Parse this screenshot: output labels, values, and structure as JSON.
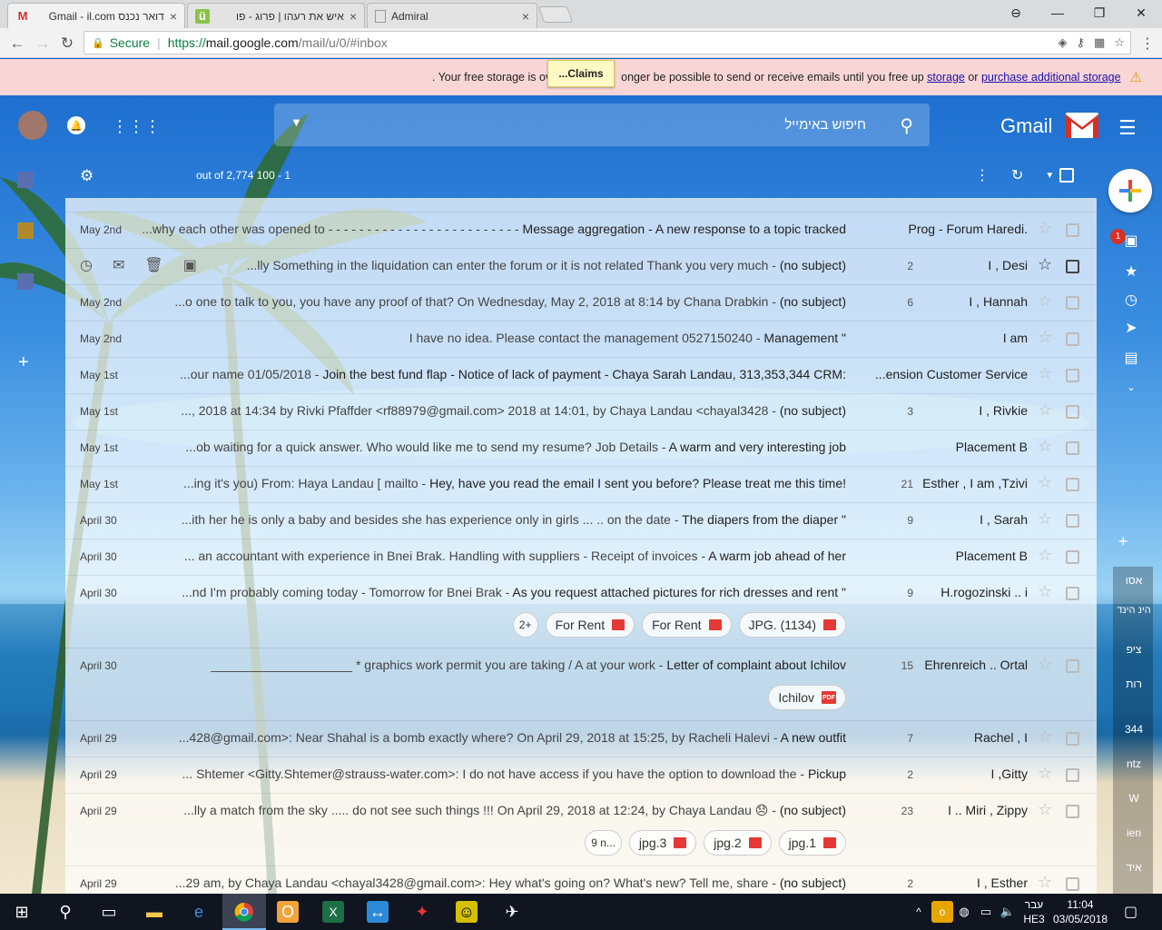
{
  "browser": {
    "tabs": [
      {
        "title": "דואר נכנס Gmail - il.com",
        "icon": "gmail-icon"
      },
      {
        "title": "איש את רעהו | פרוג - פו",
        "icon": "prog-icon"
      },
      {
        "title": "Admiral",
        "icon": "page-icon"
      }
    ],
    "close_glyph": "×",
    "url_secure_label": "Secure",
    "url_protocol": "https://",
    "url_host": "mail.google.com",
    "url_path": "/mail/u/0/#inbox"
  },
  "storage_warning": {
    "text_before": "Your free storage is ov",
    "text_mid": "onger be possible to send or receive emails until you free up",
    "link_storage": "storage",
    "or": "or",
    "link_purchase": "purchase additional storage",
    "trailing_dot": "."
  },
  "claims_popup": "...Claims",
  "gmail": {
    "logo_word": "Gmail",
    "search_placeholder": "חיפוש באימייל",
    "page_count": "out of 2,774 100 - 1"
  },
  "inbox_badge": "1",
  "hangouts_right": [
    "אסו",
    "הינ הינד",
    "ציפ",
    "רות",
    "344",
    "ntz",
    "W",
    "ien",
    "איד"
  ],
  "messages": [
    {
      "date": "May 2nd",
      "subject": "Message aggregation - A new response to a topic tracked",
      "snippet": "...why each other was opened to - - - - - - - - - - - - - - - - - - - - - - - -",
      "count": "",
      "sender": "Prog - Forum Haredi.",
      "chips": []
    },
    {
      "date": "",
      "subject": "(no subject)",
      "snippet": "...lly Something in the liquidation can enter the forum or it is not related Thank you very much",
      "count": "2",
      "sender": "I , Desi",
      "chips": [],
      "hover": true
    },
    {
      "date": "May 2nd",
      "subject": "(no subject)",
      "snippet": "...o one to talk to you, you have any proof of that? On Wednesday, May 2, 2018 at 8:14 by Chana Drabkin",
      "count": "6",
      "sender": "I , Hannah",
      "chips": []
    },
    {
      "date": "May 2nd",
      "subject": "Management \"",
      "snippet": "I have no idea. Please contact the management 0527150240",
      "count": "",
      "sender": "I am",
      "chips": []
    },
    {
      "date": "May 1st",
      "subject": "Join the best fund flap - Notice of lack of payment - Chaya Sarah Landau, 313,353,344 CRM:",
      "snippet": "...our name 01/05/2018",
      "count": "",
      "sender": "...ension Customer Service",
      "chips": []
    },
    {
      "date": "May 1st",
      "subject": "(no subject)",
      "snippet": "..., 2018 at 14:34 by Rivki Pfaffder <rf88979@gmail.com> 2018 at 14:01, by Chaya Landau <chayal3428",
      "count": "3",
      "sender": "I , Rivkie",
      "chips": []
    },
    {
      "date": "May 1st",
      "subject": "A warm and very interesting job",
      "snippet": "...ob waiting for a quick answer. Who would like me to send my resume? Job Details",
      "count": "",
      "sender": "Placement B",
      "chips": []
    },
    {
      "date": "May 1st",
      "subject": "Hey, have you read the email I sent you before? Please treat me this time!",
      "snippet": "...ing it's you) From: Haya Landau [ mailto",
      "count": "21",
      "sender": "Esther , I am ,Tzivi",
      "chips": []
    },
    {
      "date": "April 30",
      "subject": "The diapers from the diaper \"",
      "snippet": "...ith her he is only a baby and besides she has experience only in girls ... .. on the date",
      "count": "9",
      "sender": "I , Sarah",
      "chips": []
    },
    {
      "date": "April 30",
      "subject": "A warm job ahead of her",
      "snippet": "... an accountant with experience in Bnei Brak. Handling with suppliers - Receipt of invoices",
      "count": "",
      "sender": "Placement B",
      "chips": []
    },
    {
      "date": "April 30",
      "subject": "As you request attached pictures for rich dresses and rent \"",
      "snippet": "...nd I'm probably coming today - Tomorrow for Bnei Brak",
      "count": "9",
      "sender": "H.rogozinski .. i",
      "chips": [
        {
          "label": "JPG. (1134)",
          "type": "image"
        },
        {
          "label": "For Rent",
          "type": "image"
        },
        {
          "label": "For Rent",
          "type": "image"
        },
        {
          "label": "2+",
          "type": "more"
        }
      ]
    },
    {
      "date": "April 30",
      "subject": "Letter of complaint about Ichilov",
      "snippet": "____________________ * graphics work permit you are taking / A at your work",
      "count": "15",
      "sender": "Ehrenreich .. Ortal",
      "chips": [
        {
          "label": "Ichilov",
          "type": "pdf"
        }
      ]
    },
    {
      "date": "April 29",
      "subject": "A new outfit",
      "snippet": "...428@gmail.com>: Near Shahal is a bomb exactly where? On April 29, 2018 at 15:25, by Racheli Halevi",
      "count": "7",
      "sender": "Rachel , I",
      "chips": []
    },
    {
      "date": "April 29",
      "subject": "Pickup",
      "snippet": "... Shtemer <Gitty.Shtemer@strauss-water.com>: I do not have access if you have the option to download the",
      "count": "2",
      "sender": "I ,Gitty",
      "chips": []
    },
    {
      "date": "April 29",
      "subject": "(no subject)",
      "snippet": "...lly a match from the sky ..... do not see such things !!! On April 29, 2018 at 12:24, by Chaya Landau 😞",
      "count": "23",
      "sender": "I .. Miri , Zippy",
      "chips": [
        {
          "label": "jpg.1",
          "type": "image"
        },
        {
          "label": "jpg.2",
          "type": "image"
        },
        {
          "label": "jpg.3",
          "type": "image"
        },
        {
          "label": "9 n...",
          "type": "more"
        }
      ]
    },
    {
      "date": "April 29",
      "subject": "(no subject)",
      "snippet": "...29 am, by Chaya Landau <chayal3428@gmail.com>: Hey what's going on? What's new? Tell me, share",
      "count": "2",
      "sender": "I , Esther",
      "chips": []
    }
  ],
  "taskbar": {
    "lang_top": "עבר",
    "lang_bottom": "HE3",
    "time": "11:04",
    "date": "03/05/2018"
  }
}
